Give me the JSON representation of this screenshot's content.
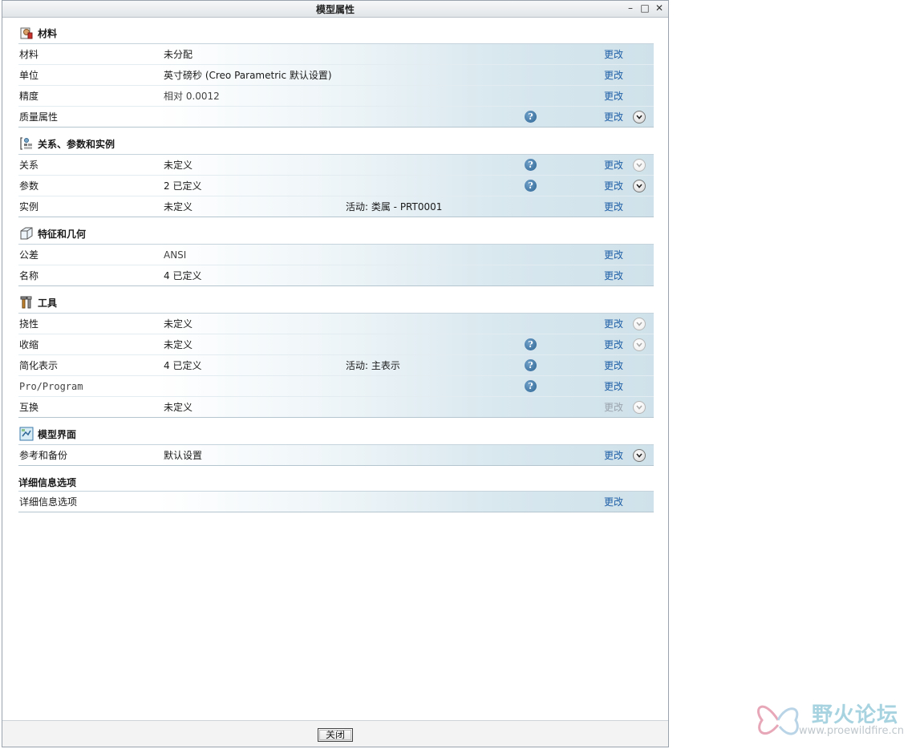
{
  "window": {
    "title": "模型属性",
    "close_button": "关闭"
  },
  "change_label": "更改",
  "sections": [
    {
      "title": "材料",
      "rows": [
        {
          "label": "材料",
          "value": "未分配"
        },
        {
          "label": "单位",
          "value": "英寸磅秒 (Creo Parametric 默认设置)"
        },
        {
          "label": "精度",
          "value": "相对 0.0012"
        },
        {
          "label": "质量属性",
          "value": ""
        }
      ]
    },
    {
      "title": "关系、参数和实例",
      "rows": [
        {
          "label": "关系",
          "value": "未定义"
        },
        {
          "label": "参数",
          "value": "2 已定义"
        },
        {
          "label": "实例",
          "value": "未定义",
          "active": "活动: 类属 - PRT0001"
        }
      ]
    },
    {
      "title": "特征和几何",
      "rows": [
        {
          "label": "公差",
          "value": "ANSI"
        },
        {
          "label": "名称",
          "value": "4 已定义"
        }
      ]
    },
    {
      "title": "工具",
      "rows": [
        {
          "label": "挠性",
          "value": "未定义"
        },
        {
          "label": "收缩",
          "value": "未定义"
        },
        {
          "label": "简化表示",
          "value": "4 已定义",
          "active": "活动: 主表示"
        },
        {
          "label": "Pro/Program",
          "value": ""
        },
        {
          "label": "互换",
          "value": "未定义"
        }
      ]
    },
    {
      "title": "模型界面",
      "rows": [
        {
          "label": "参考和备份",
          "value": "默认设置"
        }
      ]
    },
    {
      "title": "详细信息选项",
      "rows": [
        {
          "label": "详细信息选项",
          "value": ""
        }
      ]
    }
  ],
  "watermark": {
    "title": "野火论坛",
    "url": "www.proewildfire.cn"
  },
  "icons": [
    "material-icon",
    "relations-icon",
    "features-icon",
    "tools-icon",
    "model-interface-icon",
    "info-icon",
    "chevron-down-icon",
    "minimize-icon",
    "maximize-icon",
    "close-icon"
  ]
}
